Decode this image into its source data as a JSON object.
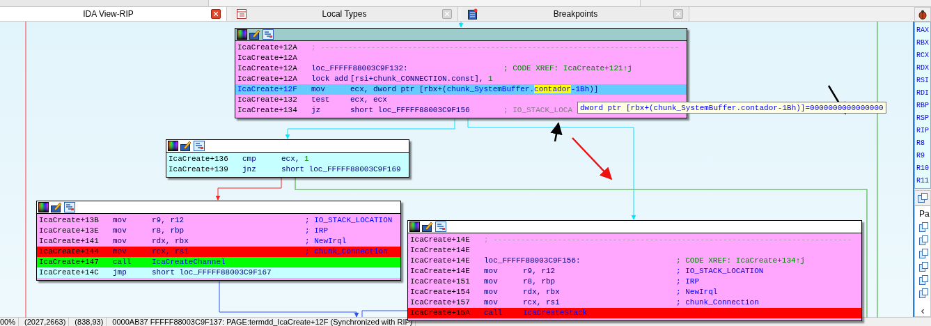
{
  "tabs": [
    {
      "label": "IDA View-RIP",
      "selected": true,
      "kind": "view"
    },
    {
      "label": "Local Types",
      "selected": false,
      "kind": "types"
    },
    {
      "label": "Breakpoints",
      "selected": false,
      "kind": "breakpoints"
    }
  ],
  "graph": {
    "nodes": [
      {
        "selected": true,
        "color": "#ffa6ff",
        "lines": [
          {
            "kind": "separator",
            "addr": "IcaCreate+12A",
            "text": "; ------------------------------------------------------------------------------",
            "color": "#ffa6ff",
            "current": false
          },
          {
            "kind": "blank",
            "addr": "IcaCreate+12A",
            "color": "#ffa6ff",
            "current": false
          },
          {
            "kind": "label",
            "addr": "IcaCreate+12A",
            "label": "loc_FFFFF88003C9F132:",
            "comment": {
              "kind": "xref",
              "text": "; CODE XREF: IcaCreate+121↑j"
            },
            "color": "#ffa6ff",
            "current": false
          },
          {
            "kind": "code",
            "addr": "IcaCreate+12A",
            "mnem": "lock add",
            "ops": [
              {
                "kind": "plain",
                "text": "[rsi+chunk_CONNECTION.const], "
              },
              {
                "kind": "num",
                "text": "1"
              }
            ],
            "color": "#ffa6ff",
            "current": false
          },
          {
            "kind": "code",
            "addr": "IcaCreate+12F",
            "mnem": "mov",
            "ops": [
              {
                "kind": "plain",
                "text": "ecx, dword ptr [rbx+("
              },
              {
                "kind": "name",
                "text": "chunk_SystemBuffer."
              },
              {
                "kind": "highlight",
                "text": "contador"
              },
              {
                "kind": "name",
                "text": "-1Bh"
              },
              {
                "kind": "plain",
                "text": ")]"
              }
            ],
            "color": "#66ccff",
            "current": true
          },
          {
            "kind": "code",
            "addr": "IcaCreate+132",
            "mnem": "test",
            "ops": [
              {
                "kind": "plain",
                "text": "ecx, ecx"
              }
            ],
            "color": "#ffa6ff",
            "current": false
          },
          {
            "kind": "code",
            "addr": "IcaCreate+134",
            "mnem": "jz",
            "ops": [
              {
                "kind": "plain",
                "text": "short loc_FFFFF88003C9F156"
              }
            ],
            "comment": {
              "kind": "faded",
              "text": "; IO_STACK_LOCA"
            },
            "color": "#ffa6ff",
            "current": false
          }
        ]
      },
      {
        "selected": false,
        "color": "#c6ffff",
        "lines": [
          {
            "kind": "code",
            "addr": "IcaCreate+136",
            "mnem": "cmp",
            "ops": [
              {
                "kind": "plain",
                "text": "ecx, "
              },
              {
                "kind": "num",
                "text": "1"
              }
            ],
            "color": "#c6ffff",
            "current": false
          },
          {
            "kind": "code",
            "addr": "IcaCreate+139",
            "mnem": "jnz",
            "ops": [
              {
                "kind": "plain",
                "text": "short loc_FFFFF88003C9F169"
              }
            ],
            "color": "#c6ffff",
            "current": false
          }
        ]
      },
      {
        "selected": false,
        "color": "#ffa6ff",
        "lines": [
          {
            "kind": "code",
            "addr": "IcaCreate+13B",
            "mnem": "mov",
            "ops": [
              {
                "kind": "plain",
                "text": "r9, r12"
              }
            ],
            "comment": {
              "kind": "note",
              "text": "; IO_STACK_LOCATION"
            },
            "color": "#ffa6ff",
            "current": false
          },
          {
            "kind": "code",
            "addr": "IcaCreate+13E",
            "mnem": "mov",
            "ops": [
              {
                "kind": "plain",
                "text": "r8, rbp"
              }
            ],
            "comment": {
              "kind": "note",
              "text": "; IRP"
            },
            "color": "#ffa6ff",
            "current": false
          },
          {
            "kind": "code",
            "addr": "IcaCreate+141",
            "mnem": "mov",
            "ops": [
              {
                "kind": "plain",
                "text": "rdx, rbx"
              }
            ],
            "comment": {
              "kind": "note",
              "text": "; NewIrql"
            },
            "color": "#ffa6ff",
            "current": false
          },
          {
            "kind": "code",
            "addr": "IcaCreate+144",
            "mnem": "mov",
            "ops": [
              {
                "kind": "plain",
                "text": "rcx, rsi"
              }
            ],
            "comment": {
              "kind": "note",
              "text": "; chunk_Connection"
            },
            "color": "#ff0000",
            "current": false
          },
          {
            "kind": "code",
            "addr": "IcaCreate+147",
            "mnem": "call",
            "ops": [
              {
                "kind": "name",
                "text": "IcaCreateChannel"
              }
            ],
            "color": "#00ff00",
            "current": false
          },
          {
            "kind": "code",
            "addr": "IcaCreate+14C",
            "mnem": "jmp",
            "ops": [
              {
                "kind": "plain",
                "text": "short loc_FFFFF88003C9F167"
              }
            ],
            "color": "#c6ffff",
            "current": false
          }
        ]
      },
      {
        "selected": false,
        "color": "#ffa6ff",
        "lines": [
          {
            "kind": "separator",
            "addr": "IcaCreate+14E",
            "text": "; ------------------------------------------------------------------------------",
            "color": "#ffa6ff",
            "current": false
          },
          {
            "kind": "blank",
            "addr": "IcaCreate+14E",
            "color": "#ffa6ff",
            "current": false
          },
          {
            "kind": "label",
            "addr": "IcaCreate+14E",
            "label": "loc_FFFFF88003C9F156:",
            "comment": {
              "kind": "xref",
              "text": "; CODE XREF: IcaCreate+134↑j"
            },
            "color": "#ffa6ff",
            "current": false
          },
          {
            "kind": "code",
            "addr": "IcaCreate+14E",
            "mnem": "mov",
            "ops": [
              {
                "kind": "plain",
                "text": "r9, r12"
              }
            ],
            "comment": {
              "kind": "note",
              "text": "; IO_STACK_LOCATION"
            },
            "color": "#ffa6ff",
            "current": false
          },
          {
            "kind": "code",
            "addr": "IcaCreate+151",
            "mnem": "mov",
            "ops": [
              {
                "kind": "plain",
                "text": "r8, rbp"
              }
            ],
            "comment": {
              "kind": "note",
              "text": "; IRP"
            },
            "color": "#ffa6ff",
            "current": false
          },
          {
            "kind": "code",
            "addr": "IcaCreate+154",
            "mnem": "mov",
            "ops": [
              {
                "kind": "plain",
                "text": "rdx, rbx"
              }
            ],
            "comment": {
              "kind": "note",
              "text": "; NewIrql"
            },
            "color": "#ffa6ff",
            "current": false
          },
          {
            "kind": "code",
            "addr": "IcaCreate+157",
            "mnem": "mov",
            "ops": [
              {
                "kind": "plain",
                "text": "rcx, rsi"
              }
            ],
            "comment": {
              "kind": "note",
              "text": "; chunk_Connection"
            },
            "color": "#ffa6ff",
            "current": false
          },
          {
            "kind": "code",
            "addr": "IcaCreate+15A",
            "mnem": "call",
            "ops": [
              {
                "kind": "name",
                "text": "IcaCreateStack"
              }
            ],
            "color": "#ff0000",
            "current": false
          }
        ]
      }
    ],
    "tooltip": "dword ptr [rbx+(chunk_SystemBuffer.contador-1Bh)]=0000000000000000"
  },
  "registers": [
    "RAX",
    "RBX",
    "RCX",
    "RDX",
    "RSI",
    "RDI",
    "RBP",
    "RSP",
    "RIP",
    "R8",
    "R9",
    "R10",
    "R11"
  ],
  "side_list": {
    "header": "Pa"
  },
  "status_bar": [
    "00%",
    "(2027,2663)",
    "(838,93)",
    "0000AB37 FFFFF88003C9F137: PAGE:termdd_IcaCreate+12F (Synchronized with RIP)"
  ]
}
